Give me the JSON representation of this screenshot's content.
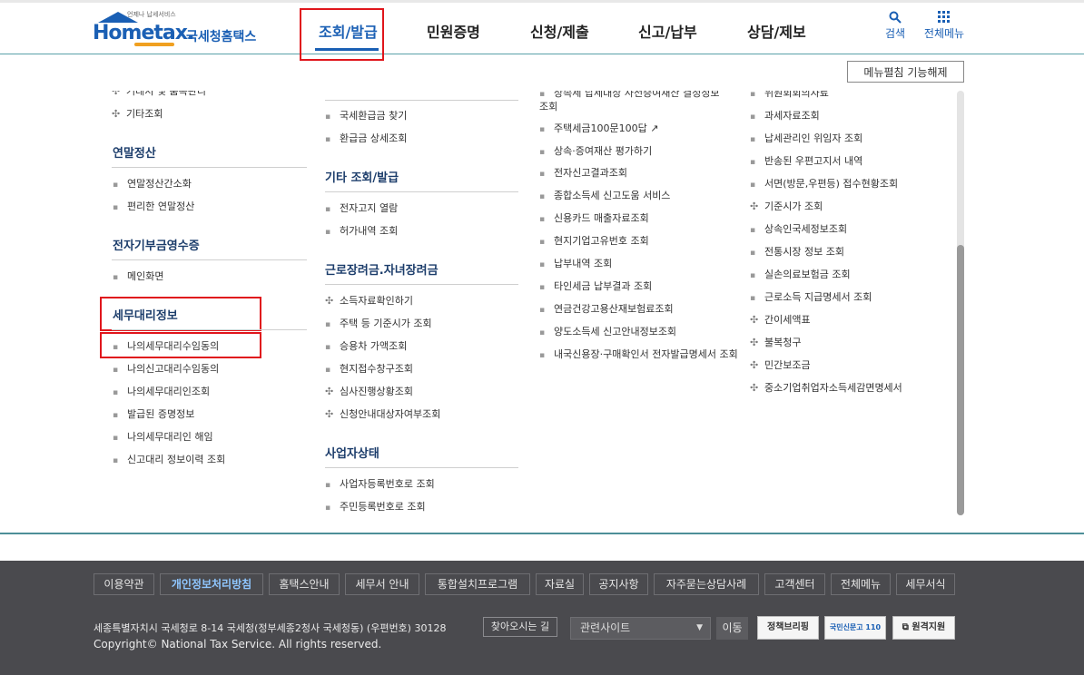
{
  "header": {
    "logo_tagline": "언제나 납세서비스",
    "logo_en": "Hometax.",
    "logo_kr": "국세청홈택스",
    "nav": [
      "조회/발급",
      "민원증명",
      "신청/제출",
      "신고/납부",
      "상담/제보"
    ],
    "search_label": "검색",
    "all_menu_label": "전체메뉴"
  },
  "menu_toggle_label": "메뉴펼침 기능해제",
  "col1": {
    "top_partial": "거래처 및 품목관리",
    "other": "기타조회",
    "sections": [
      {
        "title": "연말정산",
        "items": [
          "연말정산간소화",
          "편리한 연말정산"
        ]
      },
      {
        "title": "전자기부금영수증",
        "items": [
          "메인화면"
        ]
      },
      {
        "title": "세무대리정보",
        "items": [
          "나의세무대리수임동의",
          "나의신고대리수임동의",
          "나의세무대리인조회",
          "발급된 증명정보",
          "나의세무대리인 해임",
          "신고대리 정보이력 조회"
        ]
      }
    ]
  },
  "col2": {
    "top_items": [
      "국세환급금 찾기",
      "환급금 상세조회"
    ],
    "sections": [
      {
        "title": "기타 조회/발급",
        "items": [
          "전자고지 열람",
          "허가내역 조회"
        ]
      },
      {
        "title": "근로장려금.자녀장려금",
        "items": [
          "소득자료확인하기",
          "주택 등 기준시가 조회",
          "승용차 가액조회",
          "현지접수창구조회",
          "심사진행상황조회",
          "신청안내대상자여부조회"
        ]
      },
      {
        "title": "사업자상태",
        "items": [
          "사업자등록번호로 조회",
          "주민등록번호로 조회"
        ]
      }
    ]
  },
  "col3": {
    "items": [
      "상속세 납세대상 사전증여재산 결정정보 조회",
      "주택세금100문100답",
      "상속·증여재산 평가하기",
      "전자신고결과조회",
      "종합소득세 신고도움 서비스",
      "신용카드 매출자료조회",
      "현지기업고유번호 조회",
      "납부내역 조회",
      "타인세금 납부결과 조회",
      "연금건강고용산재보험료조회",
      "양도소득세 신고안내정보조회",
      "내국신용장·구매확인서 전자발급명세서 조회"
    ]
  },
  "col4": {
    "items": [
      "위원회회의자료",
      "과세자료조회",
      "납세관리인 위임자 조회",
      "반송된 우편고지서 내역",
      "서면(방문,우편등) 접수현황조회",
      "기준시가 조회",
      "상속인국세정보조회",
      "전통시장 정보 조회",
      "실손의료보험금 조회",
      "근로소득 지급명세서 조회",
      "간이세액표",
      "불복청구",
      "민간보조금",
      "중소기업취업자소득세감면명세서"
    ]
  },
  "footer": {
    "links": [
      "이용약관",
      "개인정보처리방침",
      "홈택스안내",
      "세무서 안내",
      "통합설치프로그램",
      "자료실",
      "공지사항",
      "자주묻는상담사례",
      "고객센터",
      "전체메뉴",
      "세무서식"
    ],
    "address": "세종특별자치시 국세청로 8-14 국세청(정부세종2청사 국세청동) (우편번호) 30128",
    "directions": "찾아오시는 길",
    "copyright": "Copyright© National Tax Service. All rights reserved.",
    "related_site": "관련사이트",
    "go": "이동",
    "btn1": "정책브리핑",
    "btn2": "국민신문고 110",
    "btn3": "원격지원"
  }
}
